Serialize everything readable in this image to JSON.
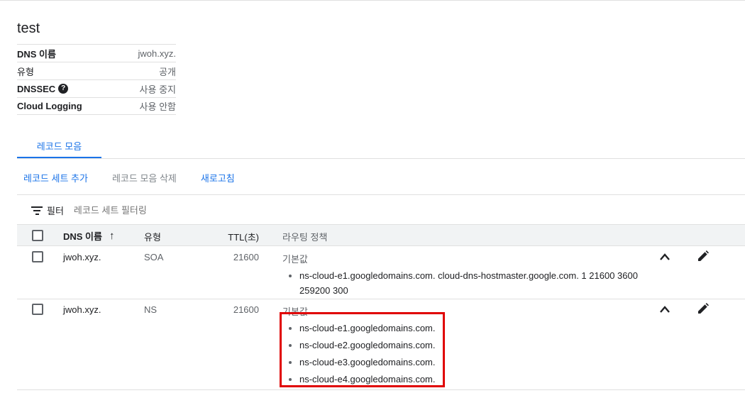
{
  "zone": {
    "title": "test",
    "details": [
      {
        "label": "DNS 이름",
        "value": "jwoh.xyz."
      },
      {
        "label": "유형",
        "value": "공개"
      },
      {
        "label": "DNSSEC",
        "value": "사용 중지"
      },
      {
        "label": "Cloud Logging",
        "value": "사용 안함"
      }
    ]
  },
  "tabs": {
    "record_sets": "레코드 모음"
  },
  "actions": {
    "add": "레코드 세트 추가",
    "delete": "레코드 모음 삭제",
    "refresh": "새로고침"
  },
  "filter": {
    "label": "필터",
    "placeholder": "레코드 세트 필터링"
  },
  "table": {
    "headers": {
      "name": "DNS 이름",
      "type": "유형",
      "ttl": "TTL(초)",
      "policy": "라우팅 정책"
    },
    "rows": [
      {
        "name": "jwoh.xyz.",
        "type": "SOA",
        "ttl": "21600",
        "policy": "기본값",
        "data": [
          "ns-cloud-e1.googledomains.com. cloud-dns-hostmaster.google.com. 1 21600 3600 259200 300"
        ]
      },
      {
        "name": "jwoh.xyz.",
        "type": "NS",
        "ttl": "21600",
        "policy": "기본값",
        "data": [
          "ns-cloud-e1.googledomains.com.",
          "ns-cloud-e2.googledomains.com.",
          "ns-cloud-e3.googledomains.com.",
          "ns-cloud-e4.googledomains.com."
        ]
      }
    ]
  },
  "colors": {
    "accent": "#1a73e8",
    "highlight": "#e00000"
  }
}
